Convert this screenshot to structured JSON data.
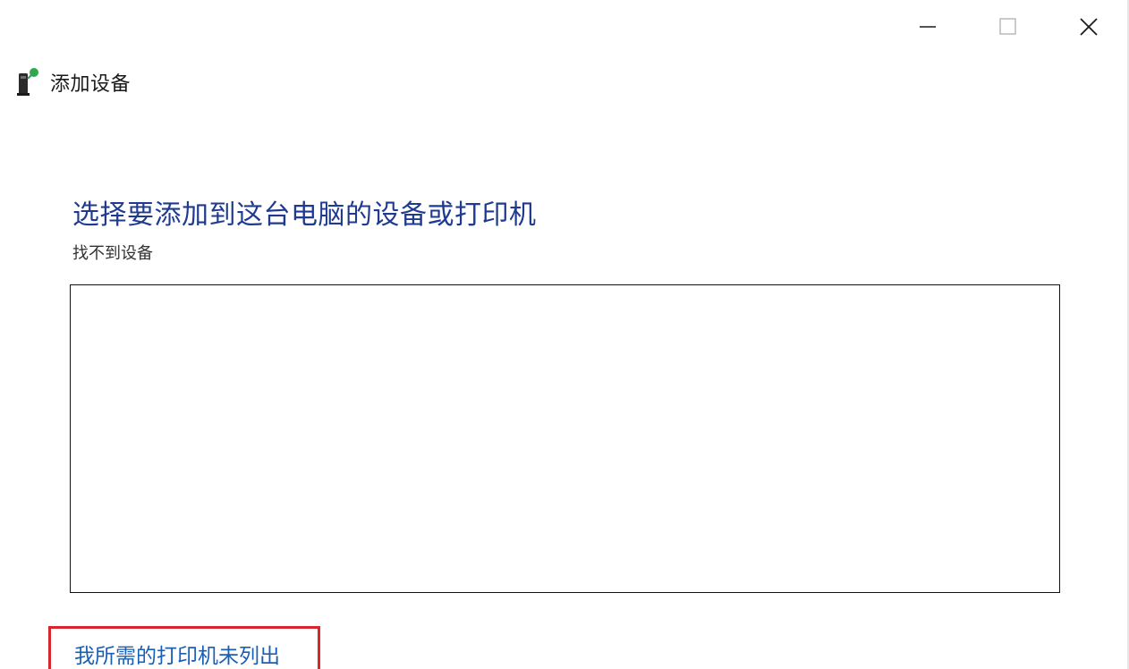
{
  "window": {
    "title": "添加设备",
    "buttons": {
      "minimize": "minimize-icon",
      "maximize": "maximize-icon",
      "close": "close-icon"
    }
  },
  "main": {
    "heading": "选择要添加到这台电脑的设备或打印机",
    "status": "找不到设备",
    "device_list": [],
    "link_text": "我所需的打印机未列出"
  },
  "colors": {
    "heading": "#1f3b8f",
    "link": "#1a5fb4",
    "highlight_box": "#d9262e"
  }
}
